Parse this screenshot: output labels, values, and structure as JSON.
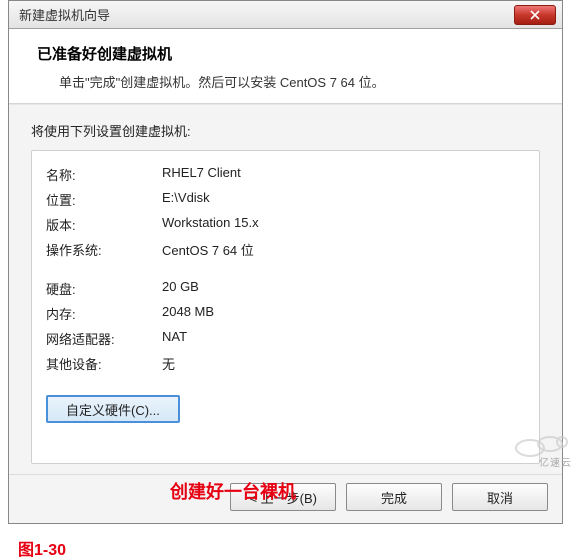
{
  "window": {
    "title": "新建虚拟机向导"
  },
  "header": {
    "heading": "已准备好创建虚拟机",
    "subtext": "单击\"完成\"创建虚拟机。然后可以安装 CentOS 7 64 位。"
  },
  "content": {
    "intro": "将使用下列设置创建虚拟机:",
    "rows1": [
      {
        "label": "名称:",
        "value": "RHEL7 Client"
      },
      {
        "label": "位置:",
        "value": "E:\\Vdisk"
      },
      {
        "label": "版本:",
        "value": "Workstation 15.x"
      },
      {
        "label": "操作系统:",
        "value": "CentOS 7 64 位"
      }
    ],
    "rows2": [
      {
        "label": "硬盘:",
        "value": "20 GB"
      },
      {
        "label": "内存:",
        "value": "2048 MB"
      },
      {
        "label": "网络适配器:",
        "value": "NAT"
      },
      {
        "label": "其他设备:",
        "value": "无"
      }
    ],
    "customize_btn": "自定义硬件(C)..."
  },
  "footer": {
    "back": "< 上一步(B)",
    "finish": "完成",
    "cancel": "取消"
  },
  "annotations": {
    "note1": "创建好一台裸机",
    "note2": "图1-30"
  }
}
